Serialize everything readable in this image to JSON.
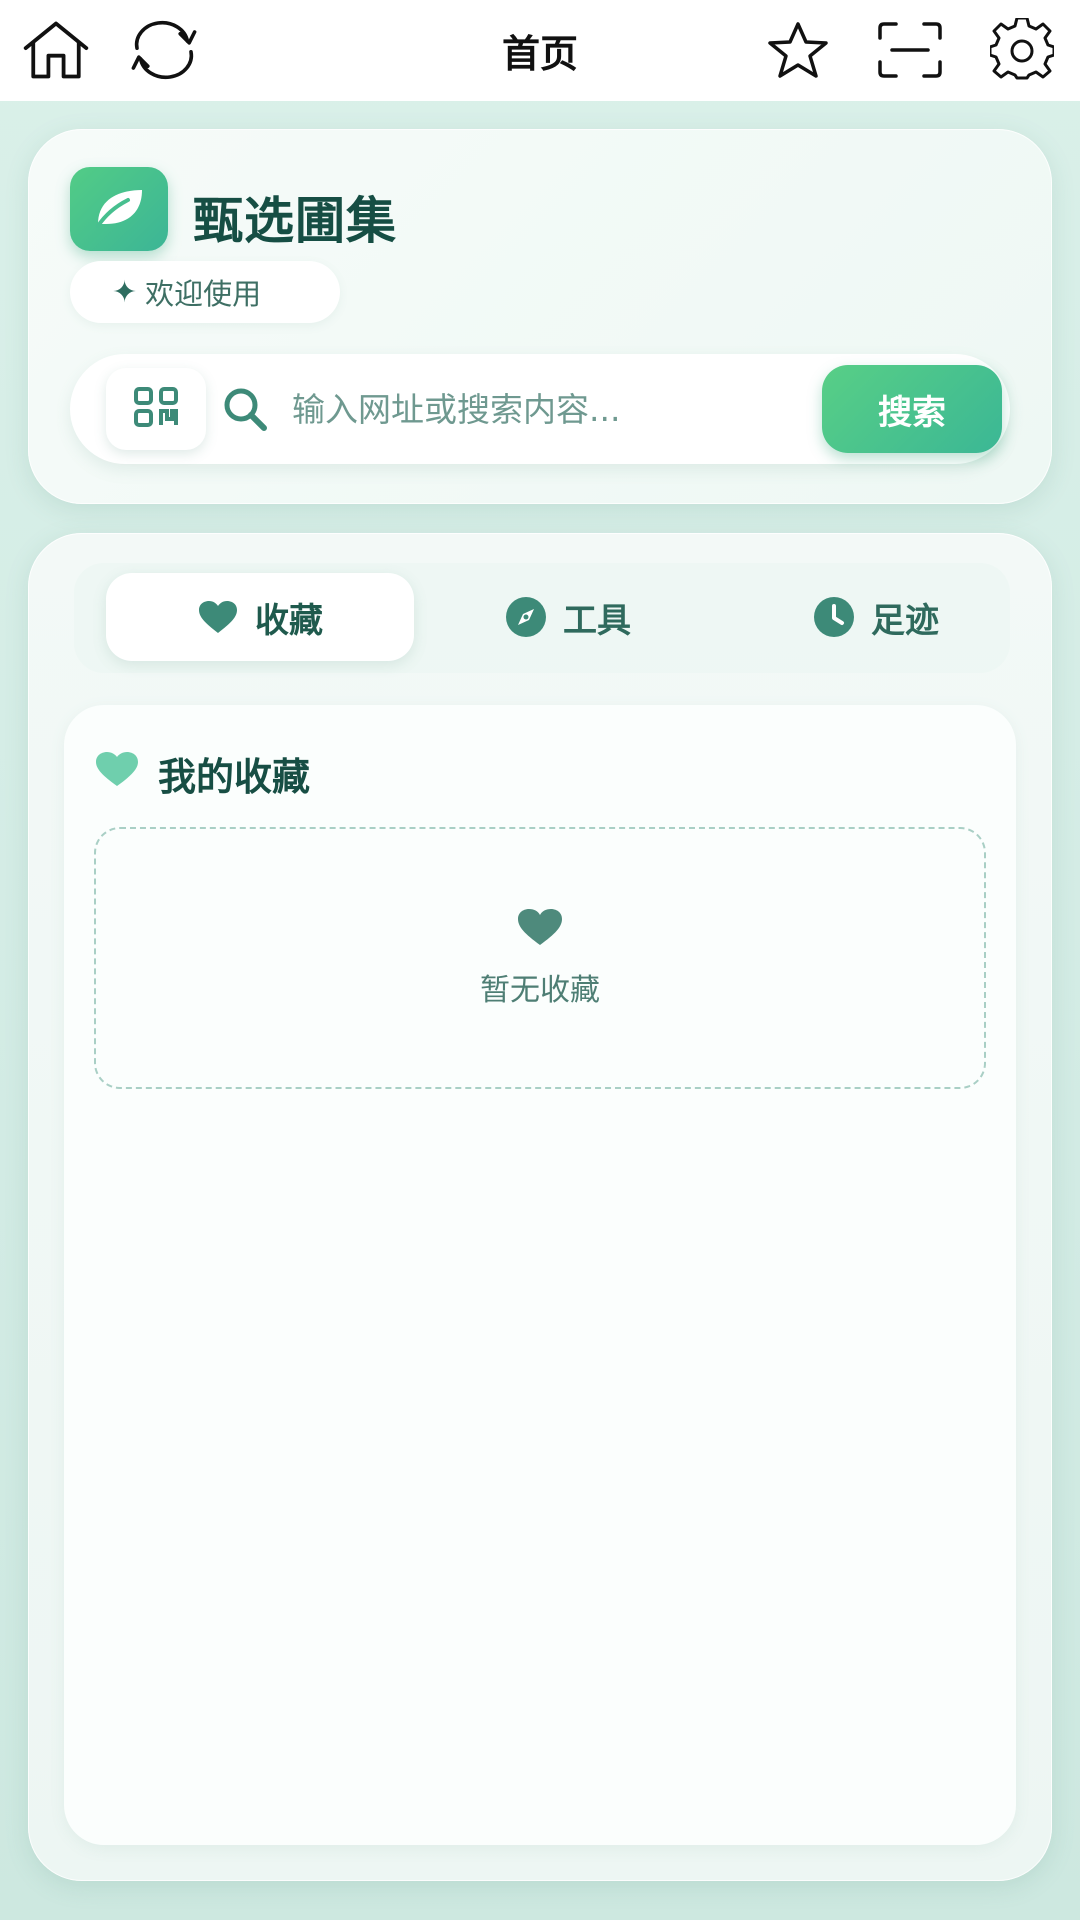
{
  "topbar": {
    "title": "首页",
    "icons": [
      "home-icon",
      "refresh-icon",
      "star-icon",
      "scan-icon",
      "gear-icon"
    ]
  },
  "header": {
    "brand_name": "甄选圃集",
    "welcome": "欢迎使用",
    "search": {
      "placeholder": "输入网址或搜索内容...",
      "button_label": "搜索"
    }
  },
  "tabs": [
    {
      "label": "收藏",
      "icon": "heart-icon",
      "active": true
    },
    {
      "label": "工具",
      "icon": "compass-icon",
      "active": false
    },
    {
      "label": "足迹",
      "icon": "clock-icon",
      "active": false
    }
  ],
  "favorites": {
    "title": "我的收藏",
    "empty_text": "暂无收藏"
  },
  "colors": {
    "accent": "#4cc48c",
    "dark_green": "#164e44",
    "icon_green": "#3d8a78"
  }
}
